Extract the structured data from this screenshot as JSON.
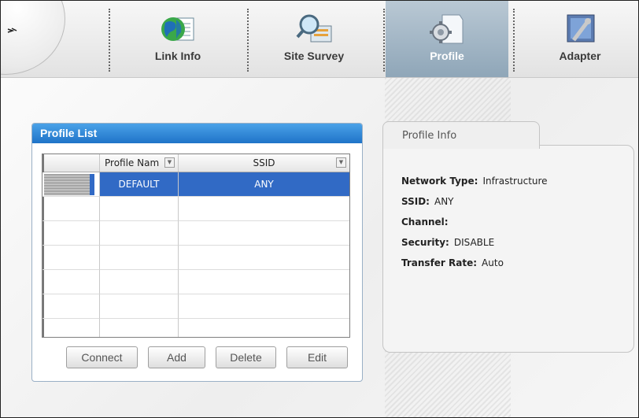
{
  "nav": {
    "tabs": [
      {
        "label": "Link Info",
        "icon": "globe-document-icon"
      },
      {
        "label": "Site Survey",
        "icon": "magnifier-network-icon"
      },
      {
        "label": "Profile",
        "icon": "gear-document-icon",
        "active": true
      },
      {
        "label": "Adapter",
        "icon": "adapter-tools-icon"
      }
    ]
  },
  "profile_list": {
    "title": "Profile List",
    "columns": [
      "Profile Nam",
      "SSID"
    ],
    "rows": [
      {
        "profile_name": "DEFAULT",
        "ssid": "ANY",
        "selected": true
      }
    ],
    "buttons": {
      "connect": "Connect",
      "add": "Add",
      "delete": "Delete",
      "edit": "Edit"
    }
  },
  "profile_info": {
    "tab": "Profile Info",
    "network_type_label": "Network Type:",
    "network_type": "Infrastructure",
    "ssid_label": "SSID:",
    "ssid": "ANY",
    "channel_label": "Channel:",
    "channel": "",
    "security_label": "Security:",
    "security": "DISABLE",
    "rate_label": "Transfer Rate:",
    "rate": "Auto"
  },
  "colors": {
    "selection": "#316ac5",
    "header_blue": "#1f73c8",
    "active_tab": "#8fa6b8"
  }
}
